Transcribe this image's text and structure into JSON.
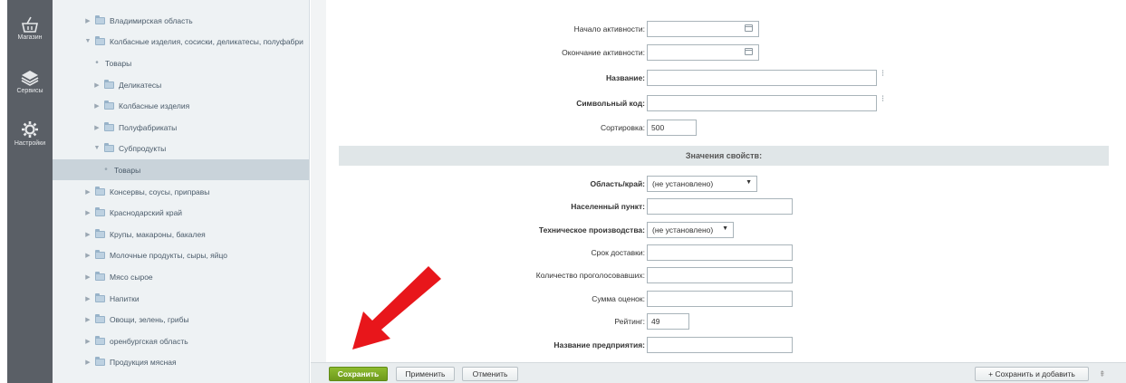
{
  "leftbar": {
    "items": [
      {
        "icon": "basket-icon",
        "label": "Магазин"
      },
      {
        "icon": "layers-icon",
        "label": "Сервисы"
      },
      {
        "icon": "gear-icon",
        "label": "Настройки"
      }
    ]
  },
  "tree": {
    "items": [
      {
        "label": "Владимирская область",
        "level": 1,
        "kind": "folder",
        "expanded": false
      },
      {
        "label": "Колбасные изделия, сосиски, деликатесы, полуфабри",
        "level": 1,
        "kind": "folder",
        "expanded": true
      },
      {
        "label": "Товары",
        "level": 2,
        "kind": "leaf"
      },
      {
        "label": "Деликатесы",
        "level": 2,
        "kind": "folder",
        "expanded": false
      },
      {
        "label": "Колбасные изделия",
        "level": 2,
        "kind": "folder",
        "expanded": false
      },
      {
        "label": "Полуфабрикаты",
        "level": 2,
        "kind": "folder",
        "expanded": false
      },
      {
        "label": "Субпродукты",
        "level": 2,
        "kind": "folder",
        "expanded": true
      },
      {
        "label": "Товары",
        "level": 3,
        "kind": "leaf",
        "selected": true
      },
      {
        "label": "Консервы, соусы, приправы",
        "level": 1,
        "kind": "folder",
        "expanded": false
      },
      {
        "label": "Краснодарский край",
        "level": 1,
        "kind": "folder",
        "expanded": false
      },
      {
        "label": "Крупы, макароны, бакалея",
        "level": 1,
        "kind": "folder",
        "expanded": false
      },
      {
        "label": "Молочные продукты, сыры, яйцо",
        "level": 1,
        "kind": "folder",
        "expanded": false
      },
      {
        "label": "Мясо сырое",
        "level": 1,
        "kind": "folder",
        "expanded": false
      },
      {
        "label": "Напитки",
        "level": 1,
        "kind": "folder",
        "expanded": false
      },
      {
        "label": "Овощи, зелень, грибы",
        "level": 1,
        "kind": "folder",
        "expanded": false
      },
      {
        "label": "оренбургская область",
        "level": 1,
        "kind": "folder",
        "expanded": false
      },
      {
        "label": "Продукция мясная",
        "level": 1,
        "kind": "folder",
        "expanded": false
      }
    ]
  },
  "form": {
    "active_from": {
      "label": "Начало активности:",
      "value": ""
    },
    "active_to": {
      "label": "Окончание активности:",
      "value": ""
    },
    "name": {
      "label": "Название:",
      "value": ""
    },
    "code": {
      "label": "Символьный код:",
      "value": ""
    },
    "sort": {
      "label": "Сортировка:",
      "value": "500"
    },
    "section_title": "Значения свойств:",
    "region": {
      "label": "Область/край:",
      "value": "(не установлено)"
    },
    "city": {
      "label": "Населенный пункт:",
      "value": ""
    },
    "production": {
      "label": "Техническое производства:",
      "value": "(не установлено)"
    },
    "delivery": {
      "label": "Срок доставки:",
      "value": ""
    },
    "votes": {
      "label": "Количество проголосовавших:",
      "value": ""
    },
    "score_sum": {
      "label": "Сумма оценок:",
      "value": ""
    },
    "rating": {
      "label": "Рейтинг:",
      "value": "49"
    },
    "company": {
      "label": "Название предприятия:",
      "value": ""
    }
  },
  "bottombar": {
    "save": "Сохранить",
    "apply": "Применить",
    "cancel": "Отменить",
    "save_add": "Сохранить и добавить"
  },
  "colors": {
    "sidebar": "#5a5f66",
    "save_button": "#7aa823",
    "annotation_arrow": "#e8161b"
  }
}
